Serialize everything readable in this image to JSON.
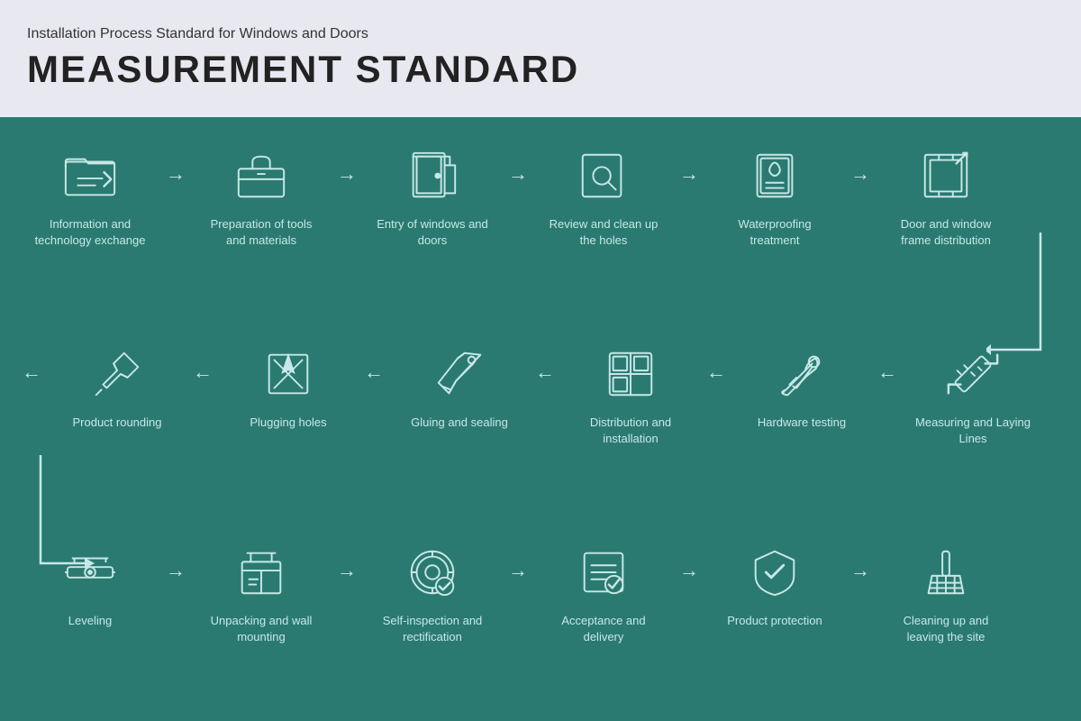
{
  "header": {
    "subtitle": "Installation Process Standard for Windows and Doors",
    "title": "MEASUREMENT STANDARD"
  },
  "rows": {
    "row1": [
      {
        "id": "info-exchange",
        "label": "Information and technology exchange",
        "icon": "folder"
      },
      {
        "id": "tools-prep",
        "label": "Preparation of tools and materials",
        "icon": "toolbox"
      },
      {
        "id": "entry-windows",
        "label": "Entry of windows and doors",
        "icon": "door-entry"
      },
      {
        "id": "review-holes",
        "label": "Review and clean up the holes",
        "icon": "magnify"
      },
      {
        "id": "waterproofing",
        "label": "Waterproofing treatment",
        "icon": "waterproof"
      },
      {
        "id": "frame-distrib",
        "label": "Door and window frame distribution",
        "icon": "frame"
      }
    ],
    "row2": [
      {
        "id": "measuring",
        "label": "Measuring and Laying Lines",
        "icon": "measure"
      },
      {
        "id": "hardware-test",
        "label": "Hardware testing",
        "icon": "wrench"
      },
      {
        "id": "distrib-install",
        "label": "Distribution and installation",
        "icon": "grid"
      },
      {
        "id": "gluing",
        "label": "Gluing and sealing",
        "icon": "glue"
      },
      {
        "id": "plugging",
        "label": "Plugging holes",
        "icon": "plug"
      },
      {
        "id": "rounding",
        "label": "Product rounding",
        "icon": "pin"
      }
    ],
    "row3": [
      {
        "id": "leveling",
        "label": "Leveling",
        "icon": "level"
      },
      {
        "id": "unpacking",
        "label": "Unpacking and wall mounting",
        "icon": "unpack"
      },
      {
        "id": "self-inspect",
        "label": "Self-inspection and rectification",
        "icon": "inspect"
      },
      {
        "id": "acceptance",
        "label": "Acceptance and delivery",
        "icon": "accept"
      },
      {
        "id": "protection",
        "label": "Product protection",
        "icon": "shield"
      },
      {
        "id": "cleanup",
        "label": "Cleaning up and leaving the site",
        "icon": "broom"
      }
    ]
  },
  "colors": {
    "bg": "#2a7a72",
    "header_bg": "#e8e8f0",
    "icon_stroke": "#c8e8e5",
    "text": "#c8e8e5"
  }
}
